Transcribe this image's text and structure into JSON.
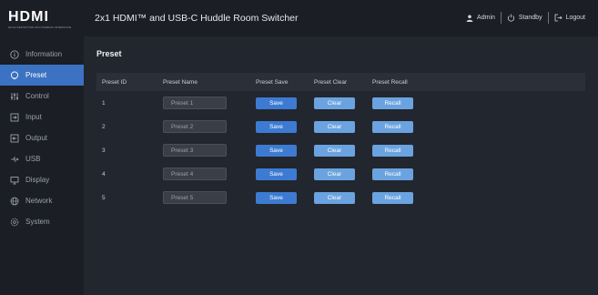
{
  "brand": {
    "logo_text": "HDMI",
    "logo_subtitle": "HIGH-DEFINITION MULTIMEDIA INTERFACE"
  },
  "header": {
    "title": "2x1 HDMI™ and USB-C Huddle Room Switcher",
    "user_label": "Admin",
    "standby_label": "Standby",
    "logout_label": "Logout"
  },
  "sidebar": {
    "items": [
      {
        "label": "Information",
        "icon": "info-icon"
      },
      {
        "label": "Preset",
        "icon": "preset-icon"
      },
      {
        "label": "Control",
        "icon": "control-icon"
      },
      {
        "label": "Input",
        "icon": "input-icon"
      },
      {
        "label": "Output",
        "icon": "output-icon"
      },
      {
        "label": "USB",
        "icon": "usb-icon"
      },
      {
        "label": "Display",
        "icon": "display-icon"
      },
      {
        "label": "Network",
        "icon": "network-icon"
      },
      {
        "label": "System",
        "icon": "system-icon"
      }
    ],
    "active_index": 1
  },
  "page": {
    "title": "Preset",
    "columns": [
      "Preset ID",
      "Preset Name",
      "Preset Save",
      "Preset Clear",
      "Preset Recall"
    ],
    "rows": [
      {
        "id": "1",
        "name": "Preset 1",
        "save": "Save",
        "clear": "Clear",
        "recall": "Recall"
      },
      {
        "id": "2",
        "name": "Preset 2",
        "save": "Save",
        "clear": "Clear",
        "recall": "Recall"
      },
      {
        "id": "3",
        "name": "Preset 3",
        "save": "Save",
        "clear": "Clear",
        "recall": "Recall"
      },
      {
        "id": "4",
        "name": "Preset 4",
        "save": "Save",
        "clear": "Clear",
        "recall": "Recall"
      },
      {
        "id": "5",
        "name": "Preset 5",
        "save": "Save",
        "clear": "Clear",
        "recall": "Recall"
      }
    ]
  },
  "colors": {
    "accent": "#3b72c2",
    "save_button": "#3d7bd2",
    "secondary_button": "#6aa3df",
    "background": "#22262e",
    "sidebar": "#1b1e24"
  }
}
